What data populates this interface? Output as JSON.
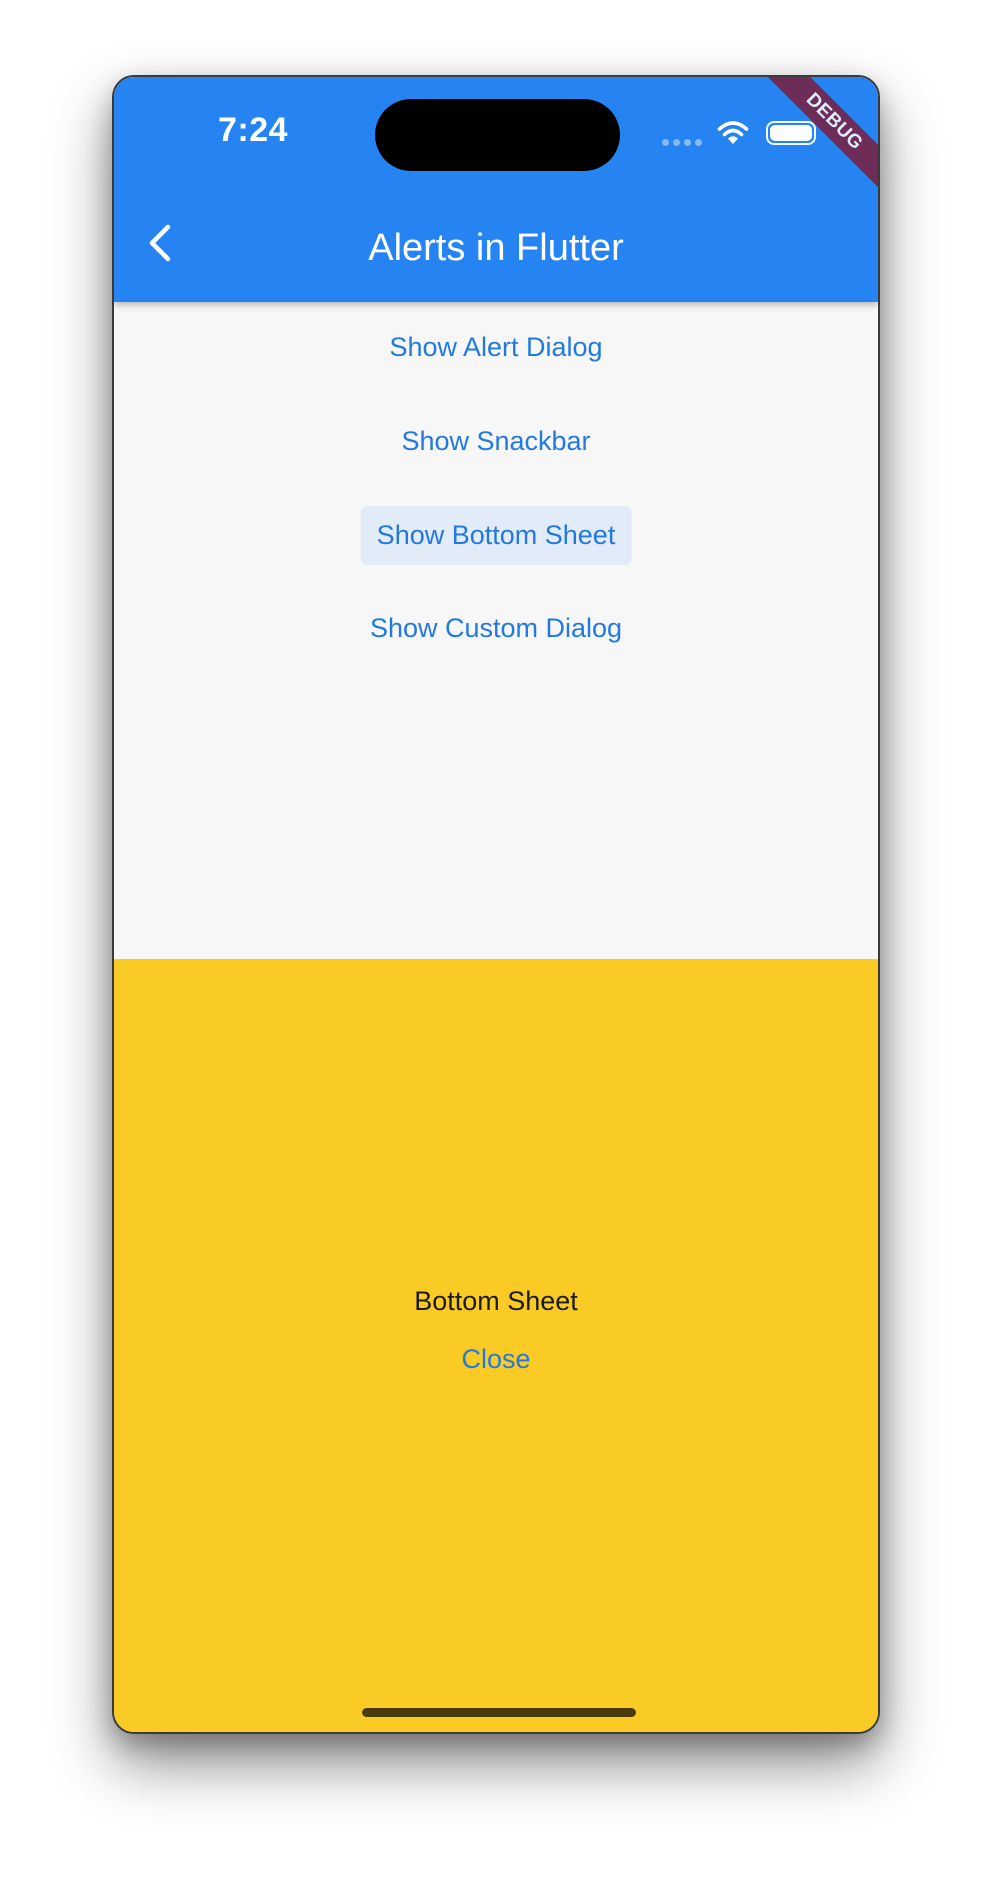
{
  "status_bar": {
    "time": "7:24",
    "signal_icon": "cellular-dots-icon",
    "wifi_icon": "wifi-icon",
    "battery_icon": "battery-icon"
  },
  "app_bar": {
    "title": "Alerts in Flutter",
    "back_icon": "chevron-left-icon",
    "background": "#2684f2"
  },
  "debug_banner": "DEBUG",
  "buttons": [
    {
      "label": "Show Alert Dialog"
    },
    {
      "label": "Show Snackbar"
    },
    {
      "label": "Show Bottom Sheet",
      "state": "pressed"
    },
    {
      "label": "Show Custom Dialog"
    }
  ],
  "bottom_sheet": {
    "text": "Bottom Sheet",
    "close_label": "Close",
    "background": "#fbcb25"
  },
  "colors": {
    "accent": "#2279e0",
    "page_background": "#f7f7f7"
  }
}
